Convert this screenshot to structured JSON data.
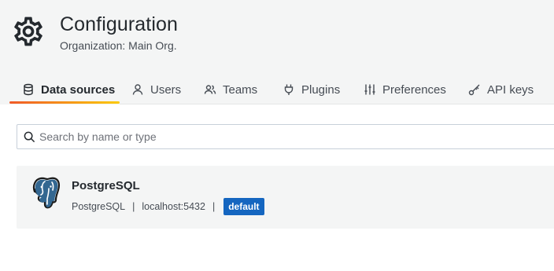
{
  "header": {
    "title": "Configuration",
    "subtitle": "Organization: Main Org.",
    "icon": "gear-icon"
  },
  "tabs": [
    {
      "label": "Data sources",
      "icon": "database-icon",
      "active": true
    },
    {
      "label": "Users",
      "icon": "user-icon",
      "active": false
    },
    {
      "label": "Teams",
      "icon": "users-icon",
      "active": false
    },
    {
      "label": "Plugins",
      "icon": "plug-icon",
      "active": false
    },
    {
      "label": "Preferences",
      "icon": "sliders-icon",
      "active": false
    },
    {
      "label": "API keys",
      "icon": "key-icon",
      "active": false
    }
  ],
  "search": {
    "placeholder": "Search by name or type",
    "value": ""
  },
  "datasources": [
    {
      "name": "PostgreSQL",
      "type": "PostgreSQL",
      "url": "localhost:5432",
      "separator": "|",
      "badge": "default",
      "icon": "postgresql-logo-icon"
    }
  ],
  "colors": {
    "accent_start": "#f05a28",
    "accent_end": "#fbca0a",
    "badge_bg": "#1566c0",
    "header_bg": "#f4f5f5"
  }
}
